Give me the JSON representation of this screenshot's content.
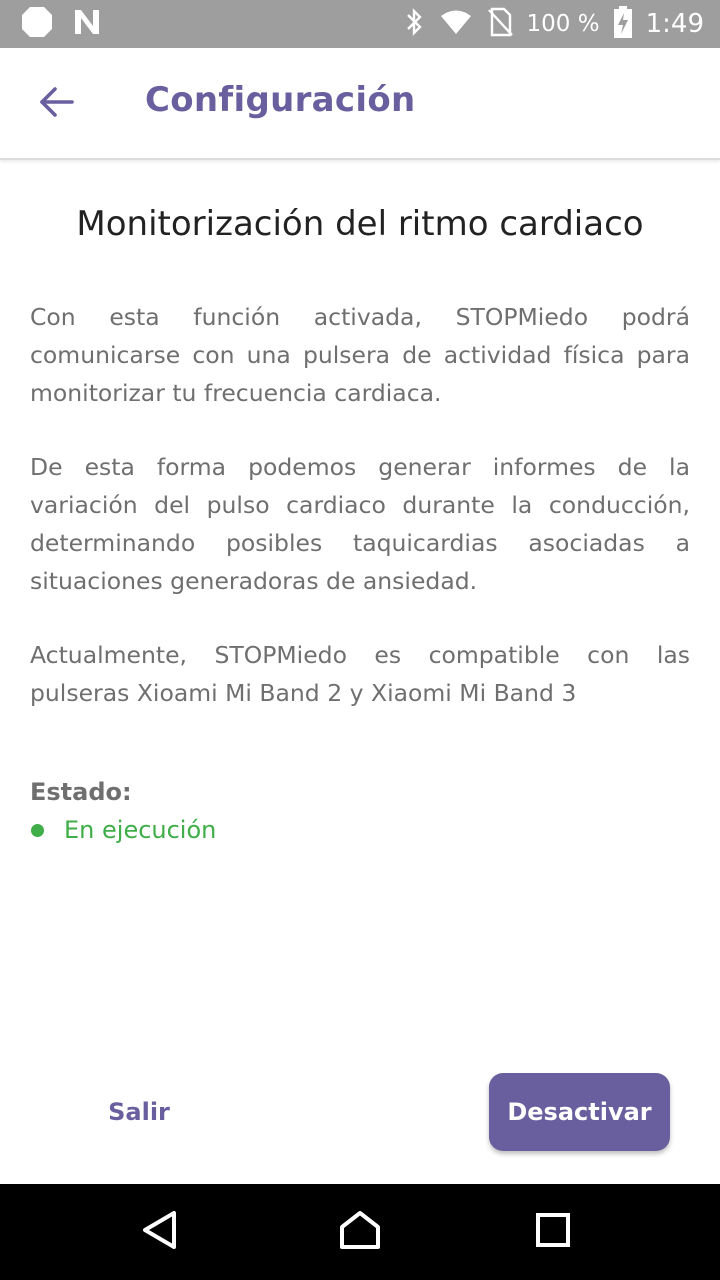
{
  "status_bar": {
    "battery_text": "100 %",
    "time": "1:49",
    "icons": [
      "circle-notification-icon",
      "n-notification-icon",
      "bluetooth-icon",
      "wifi-icon",
      "no-sim-icon",
      "battery-charging-icon"
    ]
  },
  "app_bar": {
    "title": "Configuración",
    "back_icon": "arrow-back-icon"
  },
  "main": {
    "heading": "Monitorización del ritmo cardiaco",
    "paragraphs": [
      "Con esta función activada, STOPMiedo podrá comunicarse con una pulsera de actividad física para monitorizar tu frecuencia cardiaca.",
      "De esta forma podemos generar informes de la variación del pulso cardiaco durante la conducción, determinando posibles taquicardias asociadas a situaciones generadoras de ansiedad.",
      "Actualmente, STOPMiedo es compatible con las pulseras Xioami Mi Band 2 y Xiaomi Mi Band 3"
    ],
    "status_label": "Estado:",
    "status_value": "En ejecución"
  },
  "footer": {
    "exit_label": "Salir",
    "deactivate_label": "Desactivar"
  },
  "nav_bar": {
    "icons": [
      "nav-back-icon",
      "nav-home-icon",
      "nav-recents-icon"
    ]
  },
  "colors": {
    "accent": "#6a5f9e",
    "status_ok": "#3fae49",
    "status_bar_bg": "#9e9e9e",
    "body_text": "#6f6f6f"
  }
}
